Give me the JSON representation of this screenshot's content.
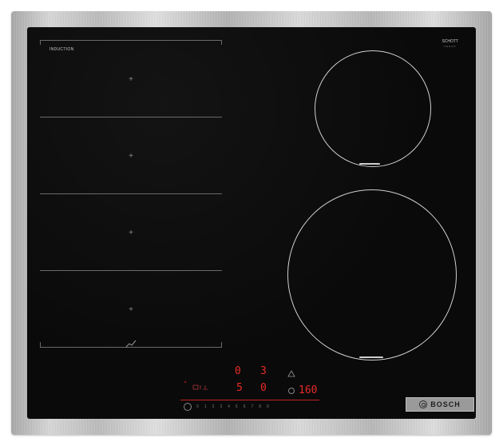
{
  "hob": {
    "label": "INDUCTION",
    "sublabel": "",
    "glass_maker": "SCHOTT",
    "glass_maker_sub": "CERAN"
  },
  "display": {
    "top_left_value": "0",
    "top_right_value": "3",
    "mid_left_value": "5",
    "mid_right_value": "0",
    "timer_value": "160"
  },
  "slider": {
    "steps": [
      "0",
      "1",
      "2",
      "3",
      "4",
      "5",
      "6",
      "7",
      "8",
      "9"
    ]
  },
  "brand": {
    "name": "BOSCH"
  },
  "colors": {
    "display_red": "#e82a2a",
    "glass": "#0a0a0a",
    "frame": "#c6c6c6"
  }
}
